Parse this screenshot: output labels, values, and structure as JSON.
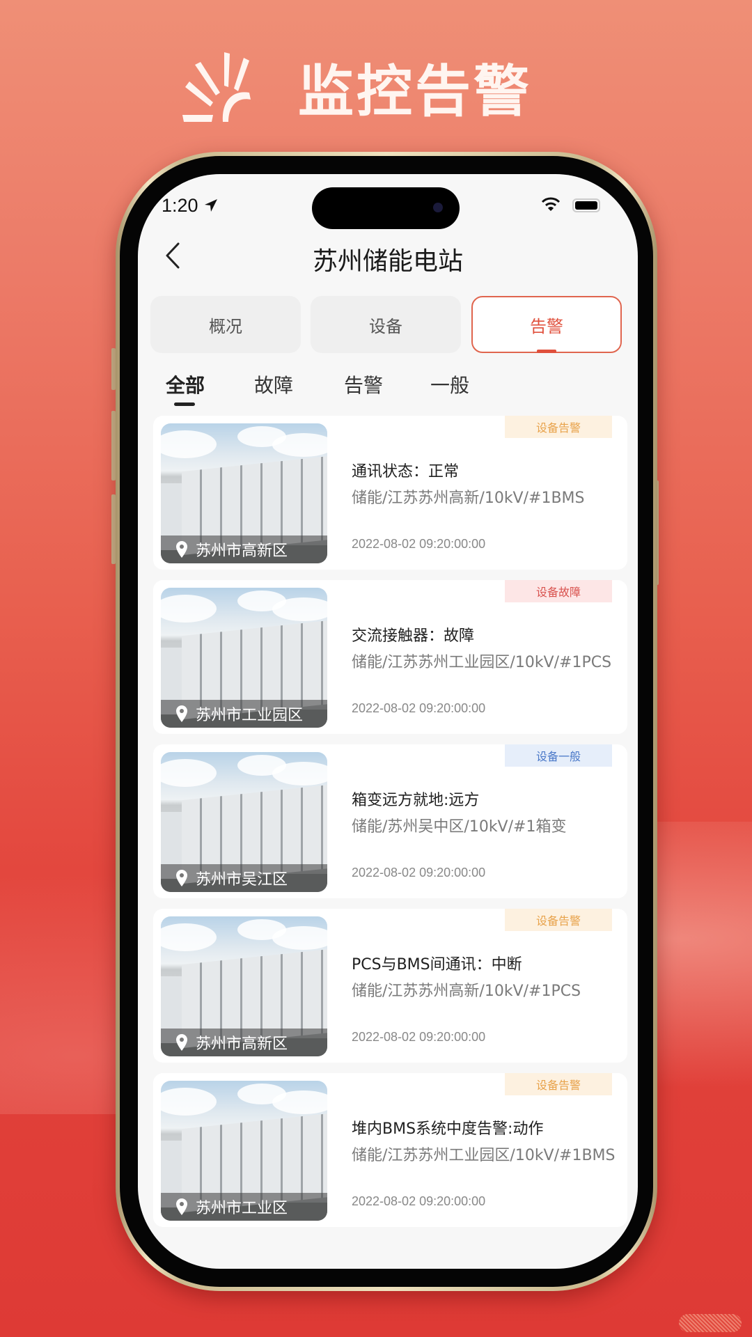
{
  "banner": {
    "logo_icon": "sun-rays-logo",
    "title": "监控告警"
  },
  "status_bar": {
    "time": "1:20",
    "location_icon": "location-arrow-icon",
    "wifi_icon": "wifi-icon",
    "battery_icon": "battery-full-icon"
  },
  "nav": {
    "back_icon": "chevron-left-icon",
    "title": "苏州储能电站"
  },
  "segments": [
    {
      "label": "概况",
      "active": false
    },
    {
      "label": "设备",
      "active": false
    },
    {
      "label": "告警",
      "active": true
    }
  ],
  "filters": [
    {
      "label": "全部",
      "active": true
    },
    {
      "label": "故障",
      "active": false
    },
    {
      "label": "告警",
      "active": false
    },
    {
      "label": "一般",
      "active": false
    }
  ],
  "colors": {
    "accent": "#e0503c",
    "badge_alarm_bg": "#fdf1e0",
    "badge_alarm_text": "#e8a24a",
    "badge_fault_bg": "#fde6e6",
    "badge_fault_text": "#d9534f",
    "badge_general_bg": "#e6eefa",
    "badge_general_text": "#4a78c8"
  },
  "alarms": [
    {
      "badge": "设备告警",
      "badge_type": "alarm",
      "title": "通讯状态：正常",
      "path": "储能/江苏苏州高新/10kV/#1BMS",
      "time": "2022-08-02 09:20:00:00",
      "location": "苏州市高新区"
    },
    {
      "badge": "设备故障",
      "badge_type": "fault",
      "title": "交流接触器：故障",
      "path": "储能/江苏苏州工业园区/10kV/#1PCS",
      "time": "2022-08-02 09:20:00:00",
      "location": "苏州市工业园区"
    },
    {
      "badge": "设备一般",
      "badge_type": "general",
      "title": "箱变远方就地:远方",
      "path": "储能/苏州吴中区/10kV/#1箱变",
      "time": "2022-08-02 09:20:00:00",
      "location": "苏州市吴江区"
    },
    {
      "badge": "设备告警",
      "badge_type": "alarm",
      "title": "PCS与BMS间通讯：中断",
      "path": "储能/江苏苏州高新/10kV/#1PCS",
      "time": "2022-08-02 09:20:00:00",
      "location": "苏州市高新区"
    },
    {
      "badge": "设备告警",
      "badge_type": "alarm",
      "title": "堆内BMS系统中度告警:动作",
      "path": "储能/江苏苏州工业园区/10kV/#1BMS",
      "time": "2022-08-02 09:20:00:00",
      "location": "苏州市工业区"
    }
  ]
}
